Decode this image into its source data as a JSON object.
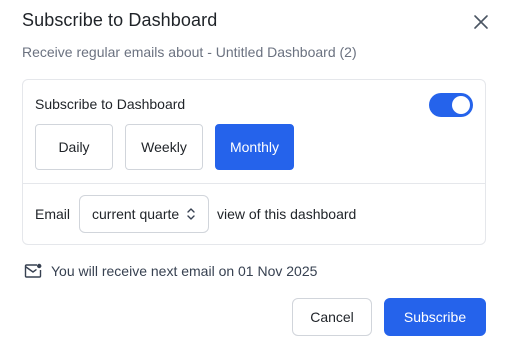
{
  "dialog": {
    "title": "Subscribe to Dashboard",
    "subtitle": "Receive regular emails about - Untitled Dashboard (2)",
    "close_icon": "close-icon"
  },
  "subscription": {
    "label": "Subscribe to Dashboard",
    "enabled": true,
    "toggle_color": "#2563eb",
    "frequencies": [
      "Daily",
      "Weekly",
      "Monthly"
    ],
    "selected_frequency": "Monthly",
    "email_label": "Email",
    "view_select": {
      "value": "current quarter",
      "icon": "chevron-updown-icon"
    },
    "view_suffix": "view of this dashboard"
  },
  "next_email": {
    "icon": "mail-icon",
    "text": "You will receive next email on 01 Nov 2025"
  },
  "footer": {
    "cancel_label": "Cancel",
    "subscribe_label": "Subscribe"
  },
  "colors": {
    "accent": "#2563eb",
    "border": "#d1d5db",
    "muted_text": "#6b7280"
  }
}
